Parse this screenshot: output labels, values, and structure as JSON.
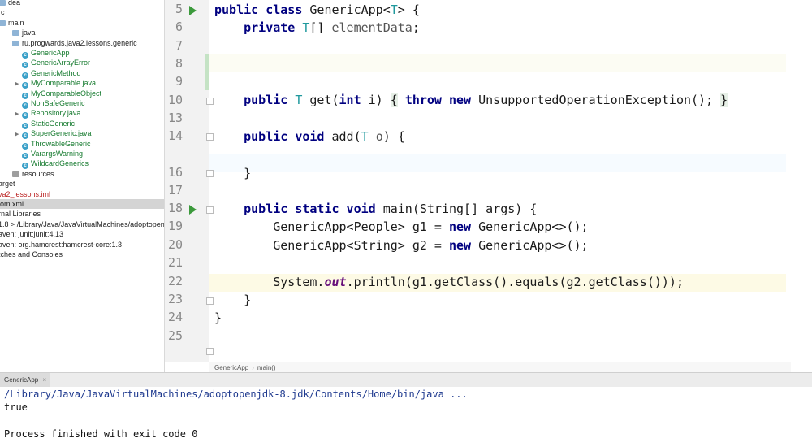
{
  "project_tree": {
    "rows": [
      {
        "label": "dea",
        "indent": 0,
        "kind": "folder",
        "color": "normal"
      },
      {
        "label": "rc",
        "indent": 0,
        "kind": "text",
        "color": "normal"
      },
      {
        "label": "main",
        "indent": 0,
        "kind": "folder",
        "color": "normal"
      },
      {
        "label": "java",
        "indent": 1,
        "kind": "folder",
        "color": "normal"
      },
      {
        "label": "ru.progwards.java2.lessons.generic",
        "indent": 1,
        "kind": "folder",
        "color": "normal"
      },
      {
        "label": "GenericApp",
        "indent": 2,
        "kind": "class",
        "color": "green"
      },
      {
        "label": "GenericArrayError",
        "indent": 2,
        "kind": "class",
        "color": "green"
      },
      {
        "label": "GenericMethod",
        "indent": 2,
        "kind": "class",
        "color": "green"
      },
      {
        "label": "MyComparable.java",
        "indent": 2,
        "kind": "class",
        "color": "green",
        "arrow": true
      },
      {
        "label": "MyComparableObject",
        "indent": 2,
        "kind": "class",
        "color": "green"
      },
      {
        "label": "NonSafeGeneric",
        "indent": 2,
        "kind": "class",
        "color": "green"
      },
      {
        "label": "Repository.java",
        "indent": 2,
        "kind": "class",
        "color": "green",
        "arrow": true
      },
      {
        "label": "StaticGeneric",
        "indent": 2,
        "kind": "class",
        "color": "green"
      },
      {
        "label": "SuperGeneric.java",
        "indent": 2,
        "kind": "class",
        "color": "green",
        "arrow": true
      },
      {
        "label": "ThrowableGeneric",
        "indent": 2,
        "kind": "class",
        "color": "green"
      },
      {
        "label": "VarargsWarning",
        "indent": 2,
        "kind": "class",
        "color": "green"
      },
      {
        "label": "WildcardGenerics",
        "indent": 2,
        "kind": "class",
        "color": "green"
      },
      {
        "label": "resources",
        "indent": 1,
        "kind": "folder-gray",
        "color": "normal"
      },
      {
        "label": "arget",
        "indent": 0,
        "kind": "text",
        "color": "normal"
      },
      {
        "label": "va2_lessons.iml",
        "indent": 0,
        "kind": "text",
        "color": "red"
      },
      {
        "label": "om.xml",
        "indent": 0,
        "kind": "text",
        "color": "normal",
        "selected": true
      },
      {
        "label": "rnal Libraries",
        "indent": 0,
        "kind": "text",
        "color": "normal"
      },
      {
        "label": "1.8 > /Library/Java/JavaVirtualMachines/adoptopen",
        "indent": 0,
        "kind": "text",
        "color": "normal"
      },
      {
        "label": "aven: junit:junit:4.13",
        "indent": 0,
        "kind": "text",
        "color": "normal"
      },
      {
        "label": "aven: org.hamcrest:hamcrest-core:1.3",
        "indent": 0,
        "kind": "text",
        "color": "normal"
      },
      {
        "label": "tches and Consoles",
        "indent": 0,
        "kind": "text",
        "color": "normal"
      }
    ]
  },
  "editor": {
    "line_numbers": [
      "5",
      "6",
      "7",
      "8",
      "9",
      "10",
      "13",
      "14",
      "16",
      "17",
      "18",
      "19",
      "20",
      "21",
      "22",
      "23",
      "24",
      "25"
    ]
  },
  "breadcrumb": {
    "items": [
      "GenericApp",
      "main()"
    ]
  },
  "run_panel": {
    "tab_label": "GenericApp"
  },
  "console": {
    "command": "/Library/Java/JavaVirtualMachines/adoptopenjdk-8.jdk/Contents/Home/bin/java ...",
    "output": "true",
    "exit_message": "Process finished with exit code 0"
  }
}
